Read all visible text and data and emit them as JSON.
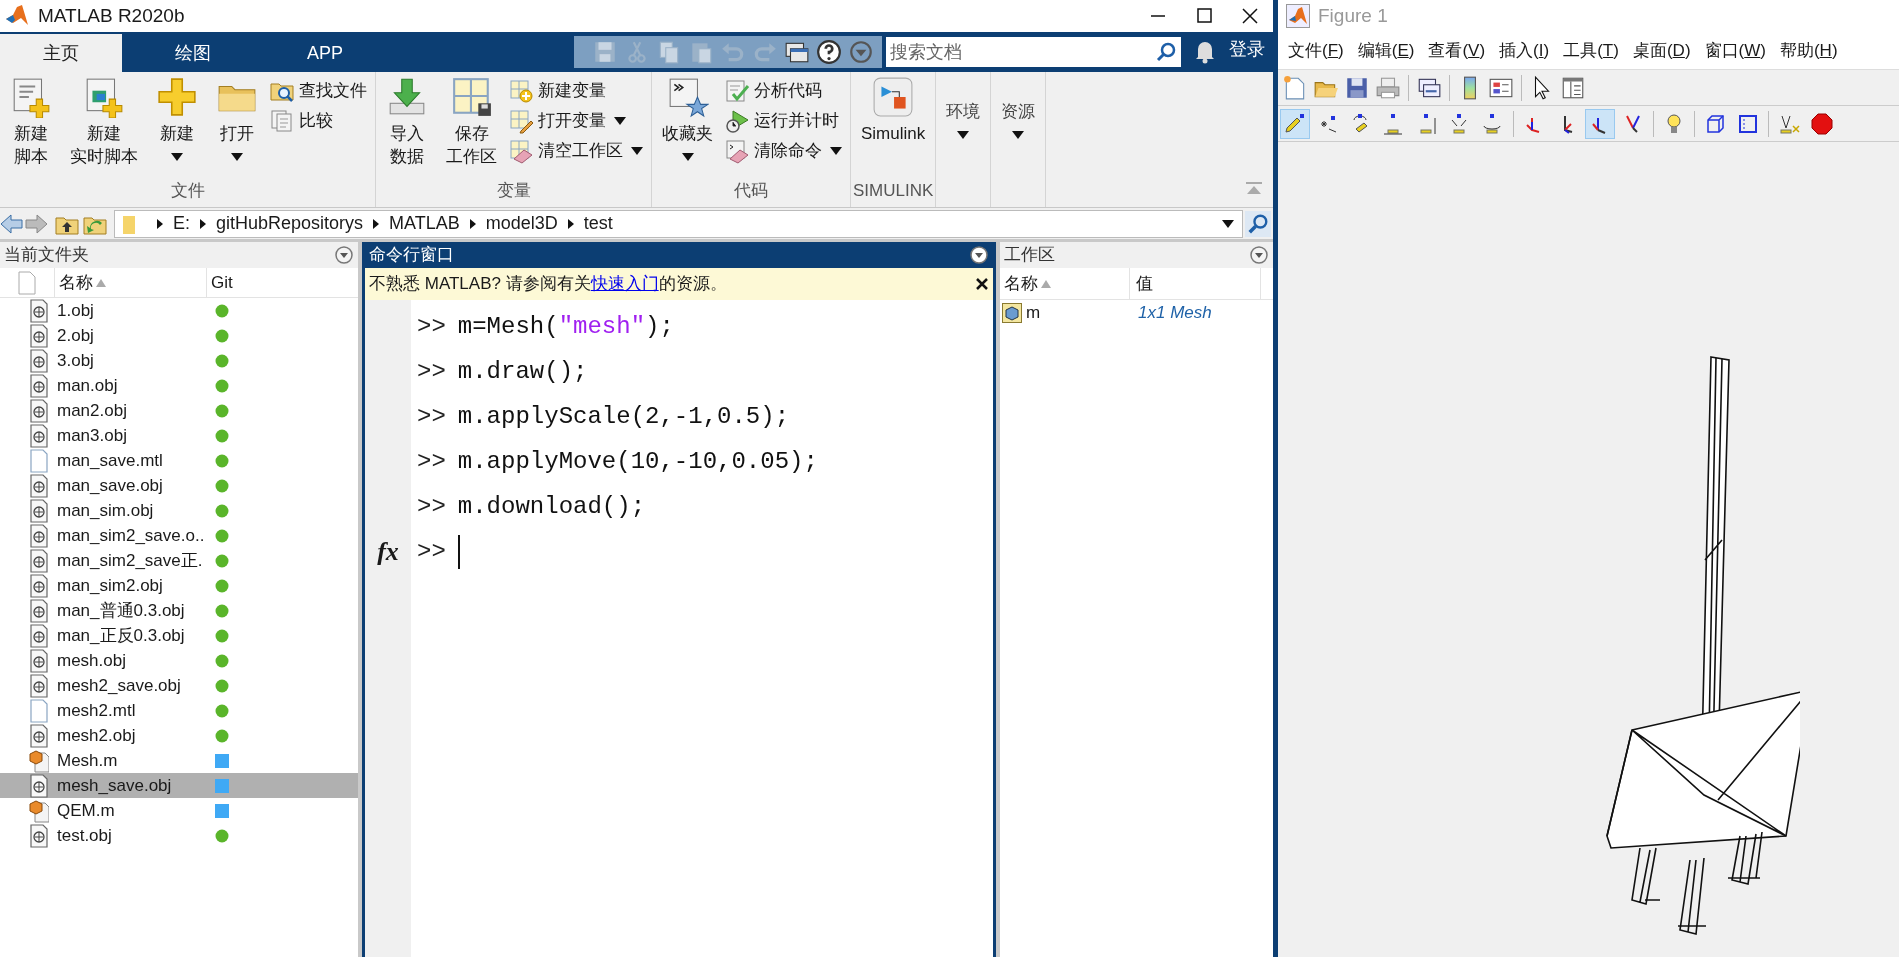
{
  "main_window": {
    "title": "MATLAB R2020b"
  },
  "ribbon_tabs": [
    {
      "label": "主页",
      "selected": true
    },
    {
      "label": "绘图",
      "selected": false
    },
    {
      "label": "APP",
      "selected": false
    }
  ],
  "search": {
    "placeholder": "搜索文档"
  },
  "login": "登录",
  "ribbon_groups": [
    {
      "label": "文件",
      "buttons": [
        {
          "kind": "large",
          "lines": [
            "新建",
            "脚本"
          ],
          "dropdown": false
        },
        {
          "kind": "large",
          "lines": [
            "新建",
            "实时脚本"
          ],
          "dropdown": false
        },
        {
          "kind": "large",
          "lines": [
            "新建"
          ],
          "dropdown": true
        },
        {
          "kind": "large",
          "lines": [
            "打开"
          ],
          "dropdown": true
        },
        {
          "kind": "stack",
          "items": [
            {
              "label": "查找文件",
              "dropdown": false
            },
            {
              "label": "比较",
              "dropdown": false
            }
          ]
        }
      ]
    },
    {
      "label": "变量",
      "buttons": [
        {
          "kind": "large",
          "lines": [
            "导入",
            "数据"
          ],
          "dropdown": false
        },
        {
          "kind": "large",
          "lines": [
            "保存",
            "工作区"
          ],
          "dropdown": false
        },
        {
          "kind": "stack",
          "items": [
            {
              "label": "新建变量",
              "dropdown": false
            },
            {
              "label": "打开变量",
              "dropdown": true
            },
            {
              "label": "清空工作区",
              "dropdown": true
            }
          ]
        }
      ]
    },
    {
      "label": "代码",
      "buttons": [
        {
          "kind": "large",
          "lines": [
            "收藏夹"
          ],
          "dropdown": true
        },
        {
          "kind": "stack",
          "items": [
            {
              "label": "分析代码",
              "dropdown": false
            },
            {
              "label": "运行并计时",
              "dropdown": false
            },
            {
              "label": "清除命令",
              "dropdown": true
            }
          ]
        }
      ]
    },
    {
      "label": "SIMULINK",
      "buttons": [
        {
          "kind": "large",
          "lines": [
            "Simulink"
          ],
          "dropdown": false
        }
      ]
    },
    {
      "buttons": [
        {
          "kind": "text",
          "lines": [
            "环境"
          ],
          "dropdown": true
        }
      ]
    },
    {
      "buttons": [
        {
          "kind": "text",
          "lines": [
            "资源"
          ],
          "dropdown": true
        }
      ]
    }
  ],
  "address": {
    "path": [
      "E:",
      "gitHubRepositorys",
      "MATLAB",
      "model3D",
      "test"
    ]
  },
  "current_folder": {
    "title": "当前文件夹",
    "columns": [
      "名称",
      "Git"
    ],
    "files": [
      {
        "name": "1.obj",
        "kind": "obj",
        "git": {
          "kind": "dot",
          "color": "#5ab52a"
        },
        "selected": false
      },
      {
        "name": "2.obj",
        "kind": "obj",
        "git": {
          "kind": "dot",
          "color": "#5ab52a"
        },
        "selected": false
      },
      {
        "name": "3.obj",
        "kind": "obj",
        "git": {
          "kind": "dot",
          "color": "#5ab52a"
        },
        "selected": false
      },
      {
        "name": "man.obj",
        "kind": "obj",
        "git": {
          "kind": "dot",
          "color": "#5ab52a"
        },
        "selected": false
      },
      {
        "name": "man2.obj",
        "kind": "obj",
        "git": {
          "kind": "dot",
          "color": "#5ab52a"
        },
        "selected": false
      },
      {
        "name": "man3.obj",
        "kind": "obj",
        "git": {
          "kind": "dot",
          "color": "#5ab52a"
        },
        "selected": false
      },
      {
        "name": "man_save.mtl",
        "kind": "plain",
        "git": {
          "kind": "dot",
          "color": "#5ab52a"
        },
        "selected": false
      },
      {
        "name": "man_save.obj",
        "kind": "obj",
        "git": {
          "kind": "dot",
          "color": "#5ab52a"
        },
        "selected": false
      },
      {
        "name": "man_sim.obj",
        "kind": "obj",
        "git": {
          "kind": "dot",
          "color": "#5ab52a"
        },
        "selected": false
      },
      {
        "name": "man_sim2_save.o..",
        "kind": "obj",
        "git": {
          "kind": "dot",
          "color": "#5ab52a"
        },
        "selected": false
      },
      {
        "name": "man_sim2_save正.",
        "kind": "obj",
        "git": {
          "kind": "dot",
          "color": "#5ab52a"
        },
        "selected": false
      },
      {
        "name": "man_sim2.obj",
        "kind": "obj",
        "git": {
          "kind": "dot",
          "color": "#5ab52a"
        },
        "selected": false
      },
      {
        "name": "man_普通0.3.obj",
        "kind": "obj",
        "git": {
          "kind": "dot",
          "color": "#5ab52a"
        },
        "selected": false
      },
      {
        "name": "man_正反0.3.obj",
        "kind": "obj",
        "git": {
          "kind": "dot",
          "color": "#5ab52a"
        },
        "selected": false
      },
      {
        "name": "mesh.obj",
        "kind": "obj",
        "git": {
          "kind": "dot",
          "color": "#5ab52a"
        },
        "selected": false
      },
      {
        "name": "mesh2_save.obj",
        "kind": "obj",
        "git": {
          "kind": "dot",
          "color": "#5ab52a"
        },
        "selected": false
      },
      {
        "name": "mesh2.mtl",
        "kind": "plain",
        "git": {
          "kind": "dot",
          "color": "#5ab52a"
        },
        "selected": false
      },
      {
        "name": "mesh2.obj",
        "kind": "obj",
        "git": {
          "kind": "dot",
          "color": "#5ab52a"
        },
        "selected": false
      },
      {
        "name": "Mesh.m",
        "kind": "class",
        "git": {
          "kind": "square",
          "color": "#3fa9f5"
        },
        "selected": false
      },
      {
        "name": "mesh_save.obj",
        "kind": "obj",
        "git": {
          "kind": "square",
          "color": "#3fa9f5"
        },
        "selected": true
      },
      {
        "name": "QEM.m",
        "kind": "class",
        "git": {
          "kind": "square",
          "color": "#3fa9f5"
        },
        "selected": false
      },
      {
        "name": "test.obj",
        "kind": "obj",
        "git": {
          "kind": "dot",
          "color": "#5ab52a"
        },
        "selected": false
      }
    ]
  },
  "command_window": {
    "title": "命令行窗口",
    "notice": {
      "before": "不熟悉 MATLAB? 请参阅有关",
      "link": "快速入门",
      "after": "的资源。"
    },
    "lines": [
      {
        "prompt": ">>",
        "parts": [
          {
            "text": "m=Mesh(",
            "kind": "code"
          },
          {
            "text": "\"mesh\"",
            "kind": "string"
          },
          {
            "text": ");",
            "kind": "code"
          }
        ]
      },
      {
        "prompt": ">>",
        "parts": [
          {
            "text": "m.draw();",
            "kind": "code"
          }
        ]
      },
      {
        "prompt": ">>",
        "parts": [
          {
            "text": "m.applyScale(2,-1,0.5);",
            "kind": "code"
          }
        ]
      },
      {
        "prompt": ">>",
        "parts": [
          {
            "text": "m.applyMove(10,-10,0.05);",
            "kind": "code"
          }
        ]
      },
      {
        "prompt": ">>",
        "parts": [
          {
            "text": "m.download();",
            "kind": "code"
          }
        ]
      }
    ],
    "function_browser": "fx",
    "current_prompt": ">>"
  },
  "workspace": {
    "title": "工作区",
    "columns": [
      "名称",
      "值"
    ],
    "variables": [
      {
        "name": "m",
        "value": "1x1 Mesh"
      }
    ]
  },
  "figure": {
    "title": "Figure 1",
    "menu": [
      {
        "before": "文件(",
        "key": "F",
        "after": ")"
      },
      {
        "before": "编辑(",
        "key": "E",
        "after": ")"
      },
      {
        "before": "查看(",
        "key": "V",
        "after": ")"
      },
      {
        "before": "插入(",
        "key": "I",
        "after": ")"
      },
      {
        "before": "工具(",
        "key": "T",
        "after": ")"
      },
      {
        "before": "桌面(",
        "key": "D",
        "after": ")"
      },
      {
        "before": "窗口(",
        "key": "W",
        "after": ")"
      },
      {
        "before": "帮助(",
        "key": "H",
        "after": ")"
      }
    ],
    "camera_toolbar": [
      {
        "selected": true
      },
      {
        "selected": false
      },
      {
        "selected": false
      },
      {
        "selected": false
      },
      {
        "selected": false
      },
      {
        "selected": false
      },
      {
        "selected": false
      },
      {
        "selected": false
      },
      {
        "selected": false
      },
      {
        "selected": true
      },
      {
        "selected": false
      },
      {
        "selected": false
      },
      {
        "selected": false
      },
      {
        "selected": false
      },
      {
        "selected": false
      },
      {
        "selected": false
      }
    ]
  }
}
